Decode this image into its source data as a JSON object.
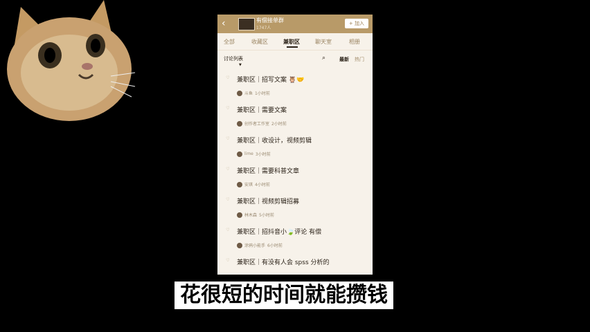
{
  "header": {
    "group_title": "有偿接单群",
    "group_sub": "1747人",
    "join_label": "+ 加入"
  },
  "tabs": [
    "全部",
    "收藏区",
    "兼职区",
    "聊天室",
    "相册"
  ],
  "active_tab": "兼职区",
  "filter": {
    "label": "讨论列表",
    "sort_new": "最新",
    "sort_hot": "热门"
  },
  "posts": [
    {
      "title": "兼职区｜招写文案 🦉🤝",
      "author": "斗鱼",
      "time": "1小时前"
    },
    {
      "title": "兼职区｜需要文案",
      "author": "创作者工作室",
      "time": "2小时前"
    },
    {
      "title": "兼职区｜收设计，视频剪辑",
      "author": "lime",
      "time": "3小时前"
    },
    {
      "title": "兼职区｜需要科普文章",
      "author": "安琪",
      "time": "4小时前"
    },
    {
      "title": "兼职区｜视频剪辑招募",
      "author": "林木森",
      "time": "5小时前"
    },
    {
      "title": "兼职区｜招抖音小🍃评论 有偿",
      "author": "涂鸦小能手",
      "time": "6小时前"
    },
    {
      "title": "兼职区｜有没有人会 spss 分析的",
      "author": "",
      "time": ""
    }
  ],
  "caption": "花很短的时间就能攒钱",
  "colors": {
    "header_bg": "#b89a68",
    "page_bg": "#f7f2ea",
    "accent_text": "#2b2218"
  }
}
